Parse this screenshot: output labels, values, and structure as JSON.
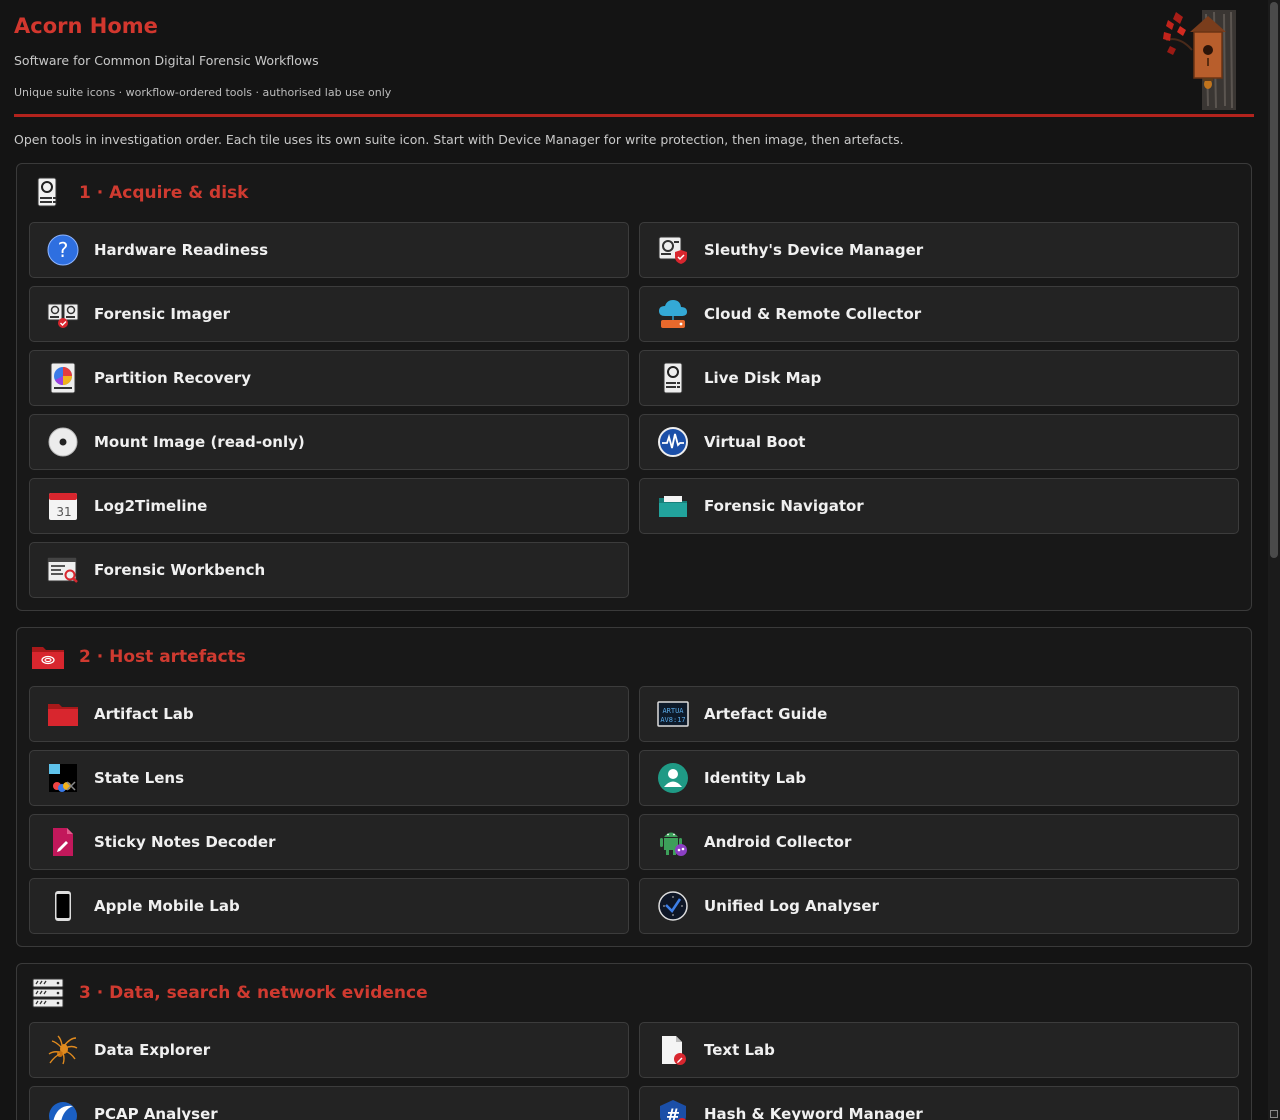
{
  "header": {
    "title": "Acorn Home",
    "subtitle": "Software for Common Digital Forensic Workflows",
    "tagline": "Unique suite icons · workflow-ordered tools · authorised lab use only"
  },
  "intro": "Open tools in investigation order. Each tile uses its own suite icon. Start with Device Manager for write protection, then image, then artefacts.",
  "sections": [
    {
      "title": "1 · Acquire & disk",
      "icon": "hard-drive-icon",
      "tiles": [
        {
          "label": "Hardware Readiness",
          "icon": "question-icon"
        },
        {
          "label": "Sleuthy's Device Manager",
          "icon": "device-shield-icon"
        },
        {
          "label": "Forensic Imager",
          "icon": "dual-drive-icon"
        },
        {
          "label": "Cloud & Remote Collector",
          "icon": "cloud-icon"
        },
        {
          "label": "Partition Recovery",
          "icon": "pie-disk-icon"
        },
        {
          "label": "Live Disk Map",
          "icon": "drive-icon"
        },
        {
          "label": "Mount Image (read-only)",
          "icon": "disc-icon"
        },
        {
          "label": "Virtual Boot",
          "icon": "pulse-icon"
        },
        {
          "label": "Log2Timeline",
          "icon": "calendar-icon"
        },
        {
          "label": "Forensic Navigator",
          "icon": "folder-icon"
        },
        {
          "label": "Forensic Workbench",
          "icon": "workbench-icon"
        }
      ]
    },
    {
      "title": "2 · Host artefacts",
      "icon": "red-folder-link-icon",
      "tiles": [
        {
          "label": "Artifact Lab",
          "icon": "red-folder-icon"
        },
        {
          "label": "Artefact Guide",
          "icon": "terminal-icon"
        },
        {
          "label": "State Lens",
          "icon": "state-lens-icon"
        },
        {
          "label": "Identity Lab",
          "icon": "user-icon"
        },
        {
          "label": "Sticky Notes Decoder",
          "icon": "note-pen-icon"
        },
        {
          "label": "Android Collector",
          "icon": "android-icon"
        },
        {
          "label": "Apple Mobile Lab",
          "icon": "phone-icon"
        },
        {
          "label": "Unified Log Analyser",
          "icon": "clock-check-icon"
        }
      ]
    },
    {
      "title": "3 · Data, search & network evidence",
      "icon": "server-rack-icon",
      "tiles": [
        {
          "label": "Data Explorer",
          "icon": "spider-icon"
        },
        {
          "label": "Text Lab",
          "icon": "document-pen-icon"
        },
        {
          "label": "PCAP Analyser",
          "icon": "shark-fin-icon"
        },
        {
          "label": "Hash & Keyword Manager",
          "icon": "hash-icon"
        }
      ]
    }
  ]
}
